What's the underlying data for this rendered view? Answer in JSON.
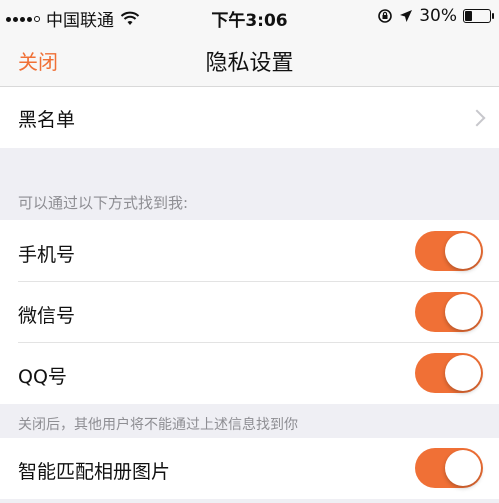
{
  "status_bar": {
    "carrier": "中国联通",
    "time": "下午3:06",
    "battery": "30%",
    "battery_fraction": 0.3
  },
  "nav": {
    "close_label": "关闭",
    "title": "隐私设置"
  },
  "blacklist": {
    "label": "黑名单"
  },
  "find_me_section": {
    "header": "可以通过以下方式找到我:",
    "items": [
      {
        "label": "手机号",
        "enabled": true
      },
      {
        "label": "微信号",
        "enabled": true
      },
      {
        "label": "QQ号",
        "enabled": true
      }
    ],
    "footer": "关闭后，其他用户将不能通过上述信息找到你"
  },
  "smart_match": {
    "label": "智能匹配相册图片",
    "enabled": true
  },
  "colors": {
    "accent": "#f07036",
    "background": "#efeff4",
    "cell": "#ffffff"
  },
  "icons": {
    "wifi": "wifi-icon",
    "orientation_lock": "orientation-lock-icon",
    "location": "location-arrow-icon",
    "battery": "battery-icon",
    "chevron": "chevron-right-icon"
  }
}
